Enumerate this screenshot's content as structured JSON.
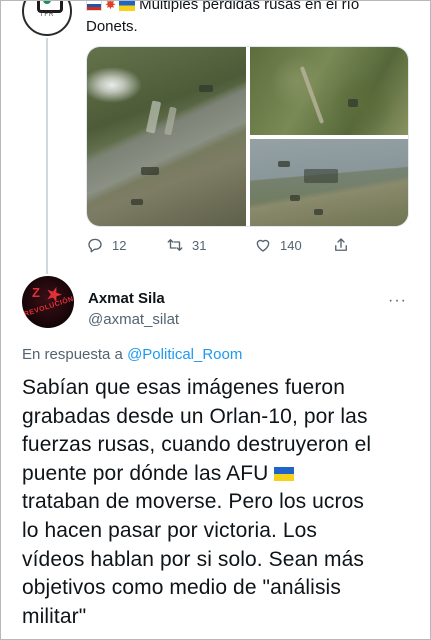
{
  "first_tweet": {
    "avatar_label": "TFR",
    "text_line1": "Múltiples pérdidas rusas en el río",
    "text_line2": "Donets.",
    "flags": [
      "flag-ru-icon",
      "collision-icon",
      "flag-ua-icon"
    ],
    "actions": {
      "reply_count": "12",
      "retweet_count": "31",
      "like_count": "140"
    }
  },
  "main_tweet": {
    "display_name": "Axmat Sila",
    "handle": "@axmat_silat",
    "avatar_text": "REVOLUCIÓN",
    "reply_prefix": "En respuesta a",
    "reply_to_handle": "@Political_Room",
    "body_line1": "Sabían que esas imágenes fueron",
    "body_line2": "grabadas desde un Orlan-10, por las",
    "body_line3": "fuerzas rusas, cuando destruyeron el",
    "body_line4": "puente por dónde las AFU",
    "body_line5": "trataban de moverse. Pero los ucros",
    "body_line6": "lo hacen pasar por victoria. Los",
    "body_line7": "vídeos hablan por si solo. Sean más",
    "body_line8": "objetivos como medio de \"análisis",
    "body_line9": "militar\""
  },
  "colors": {
    "link": "#1d9bf0",
    "muted": "#536471",
    "text": "#0f1419"
  }
}
